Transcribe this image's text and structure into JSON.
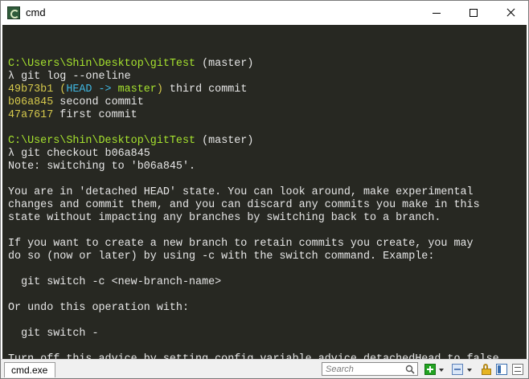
{
  "window": {
    "title": "cmd",
    "icon": "cmder-icon"
  },
  "terminal": {
    "lines": [
      {
        "segments": []
      },
      {
        "segments": [
          {
            "text": "C:\\Users\\Shin\\Desktop\\gitTest",
            "color": "#a6e22e"
          },
          {
            "text": " (master)",
            "color": "#e6e6e6"
          }
        ]
      },
      {
        "segments": [
          {
            "text": "λ git log --oneline",
            "color": "#e6e6e6"
          }
        ]
      },
      {
        "segments": [
          {
            "text": "49b73b1",
            "color": "#d6c94c"
          },
          {
            "text": " (",
            "color": "#d6c94c"
          },
          {
            "text": "HEAD -> ",
            "color": "#3fb6e0"
          },
          {
            "text": "master",
            "color": "#a6e22e"
          },
          {
            "text": ")",
            "color": "#d6c94c"
          },
          {
            "text": " third commit",
            "color": "#e6e6e6"
          }
        ]
      },
      {
        "segments": [
          {
            "text": "b06a845",
            "color": "#d6c94c"
          },
          {
            "text": " second commit",
            "color": "#e6e6e6"
          }
        ]
      },
      {
        "segments": [
          {
            "text": "47a7617",
            "color": "#d6c94c"
          },
          {
            "text": " first commit",
            "color": "#e6e6e6"
          }
        ]
      },
      {
        "segments": []
      },
      {
        "segments": [
          {
            "text": "C:\\Users\\Shin\\Desktop\\gitTest",
            "color": "#a6e22e"
          },
          {
            "text": " (master)",
            "color": "#e6e6e6"
          }
        ]
      },
      {
        "segments": [
          {
            "text": "λ git checkout b06a845",
            "color": "#e6e6e6"
          }
        ]
      },
      {
        "segments": [
          {
            "text": "Note: switching to 'b06a845'.",
            "color": "#e6e6e6"
          }
        ]
      },
      {
        "segments": []
      },
      {
        "segments": [
          {
            "text": "You are in 'detached HEAD' state. You can look around, make experimental",
            "color": "#e6e6e6"
          }
        ]
      },
      {
        "segments": [
          {
            "text": "changes and commit them, and you can discard any commits you make in this",
            "color": "#e6e6e6"
          }
        ]
      },
      {
        "segments": [
          {
            "text": "state without impacting any branches by switching back to a branch.",
            "color": "#e6e6e6"
          }
        ]
      },
      {
        "segments": []
      },
      {
        "segments": [
          {
            "text": "If you want to create a new branch to retain commits you create, you may",
            "color": "#e6e6e6"
          }
        ]
      },
      {
        "segments": [
          {
            "text": "do so (now or later) by using -c with the switch command. Example:",
            "color": "#e6e6e6"
          }
        ]
      },
      {
        "segments": []
      },
      {
        "segments": [
          {
            "text": "  git switch -c <new-branch-name>",
            "color": "#e6e6e6"
          }
        ]
      },
      {
        "segments": []
      },
      {
        "segments": [
          {
            "text": "Or undo this operation with:",
            "color": "#e6e6e6"
          }
        ]
      },
      {
        "segments": []
      },
      {
        "segments": [
          {
            "text": "  git switch -",
            "color": "#e6e6e6"
          }
        ]
      },
      {
        "segments": []
      },
      {
        "segments": [
          {
            "text": "Turn off this advice by setting config variable advice.detachedHead to false",
            "color": "#e6e6e6"
          }
        ]
      }
    ]
  },
  "statusbar": {
    "tab_label": "cmd.exe",
    "search_placeholder": "Search"
  },
  "colors": {
    "terminal_bg": "#272822",
    "path_green": "#a6e22e",
    "hash_yellow": "#d6c94c",
    "head_blue": "#3fb6e0"
  }
}
